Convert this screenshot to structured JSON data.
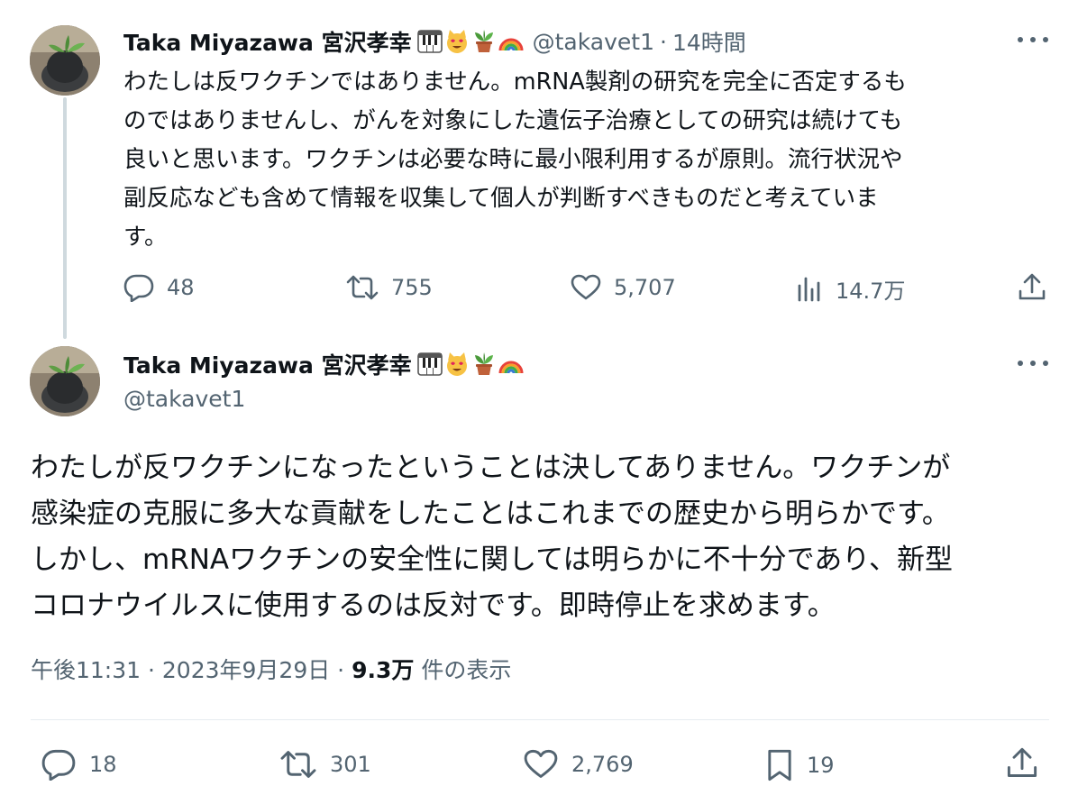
{
  "tweet1": {
    "name": "Taka Miyazawa 宮沢孝幸",
    "emoji_icons": [
      "piano-keys-icon",
      "heart-eyes-cat-icon",
      "potted-plant-icon",
      "rainbow-icon"
    ],
    "handle": "@takavet1",
    "separator": "·",
    "time": "14時間",
    "text": "わたしは反ワクチンではありません。mRNA製剤の研究を完全に否定するも\nのではありませんし、がんを対象にした遺伝子治療としての研究は続けても\n良いと思います。ワクチンは必要な時に最小限利用するが原則。流行状況や\n副反応なども含めて情報を収集して個人が判断すべきものだと考えていま\nす。",
    "replies": "48",
    "reposts": "755",
    "likes": "5,707",
    "views": "14.7万"
  },
  "tweet2": {
    "name": "Taka Miyazawa 宮沢孝幸",
    "emoji_icons": [
      "piano-keys-icon",
      "heart-eyes-cat-icon",
      "potted-plant-icon",
      "rainbow-icon"
    ],
    "handle": "@takavet1",
    "text": "わたしが反ワクチンになったということは決してありません。ワクチンが\n感染症の克服に多大な貢献をしたことはこれまでの歴史から明らかです。\nしかし、mRNAワクチンの安全性に関しては明らかに不十分であり、新型\nコロナウイルスに使用するのは反対です。即時停止を求めます。",
    "timestamp": "午後11:31 · 2023年9月29日 · ",
    "view_count": "9.3万",
    "view_label": " 件の表示",
    "replies": "18",
    "reposts": "301",
    "likes": "2,769",
    "bookmarks": "19"
  },
  "colors": {
    "text": "#0f1419",
    "secondary": "#536471",
    "thread_line": "#cfd9de"
  }
}
